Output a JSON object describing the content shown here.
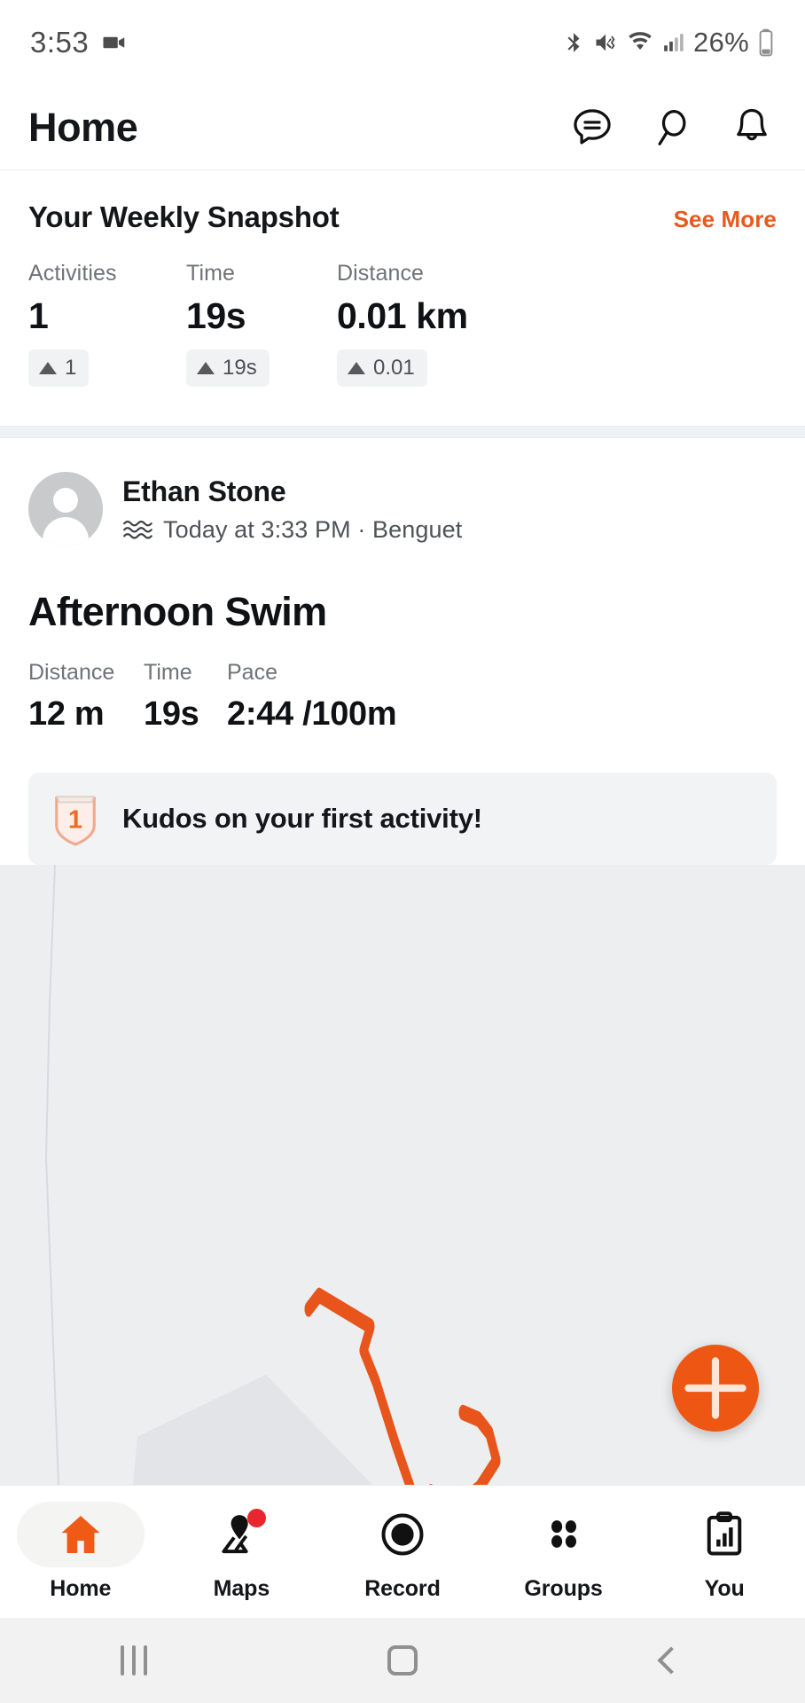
{
  "status_bar": {
    "time": "3:53",
    "battery_percent": "26%",
    "icons": [
      "video-recording-icon",
      "bluetooth-icon",
      "mute-vibrate-icon",
      "wifi-icon",
      "cellular-signal-icon",
      "battery-icon"
    ]
  },
  "app_bar": {
    "title": "Home",
    "actions": [
      {
        "name": "messages-icon",
        "label": "Messages"
      },
      {
        "name": "search-icon",
        "label": "Search"
      },
      {
        "name": "notifications-bell-icon",
        "label": "Notifications"
      }
    ]
  },
  "snapshot": {
    "title": "Your Weekly Snapshot",
    "see_more_label": "See More",
    "accent_color": "#e8591f",
    "stats": [
      {
        "label": "Activities",
        "value": "1",
        "delta": "1",
        "trend": "up"
      },
      {
        "label": "Time",
        "value": "19s",
        "delta": "19s",
        "trend": "up"
      },
      {
        "label": "Distance",
        "value": "0.01 km",
        "delta": "0.01",
        "trend": "up"
      }
    ]
  },
  "activity": {
    "user_name": "Ethan Stone",
    "sport_icon": "swim-waves-icon",
    "meta": "Today at 3:33 PM · Benguet",
    "title": "Afternoon Swim",
    "stats": [
      {
        "label": "Distance",
        "value": "12 m"
      },
      {
        "label": "Time",
        "value": "19s"
      },
      {
        "label": "Pace",
        "value": "2:44 /100m"
      }
    ],
    "kudos": {
      "badge_number": "1",
      "text": "Kudos on your first activity!"
    },
    "map": {
      "route_color": "#e8551c",
      "background_color": "#eceef0",
      "fab_label": "+",
      "fab_color": "#ee5713"
    }
  },
  "bottom_nav": {
    "items": [
      {
        "label": "Home",
        "icon": "home-icon",
        "active": true,
        "badge": false
      },
      {
        "label": "Maps",
        "icon": "maps-pin-icon",
        "active": false,
        "badge": true
      },
      {
        "label": "Record",
        "icon": "record-circle-icon",
        "active": false,
        "badge": false
      },
      {
        "label": "Groups",
        "icon": "groups-dots-icon",
        "active": false,
        "badge": false
      },
      {
        "label": "You",
        "icon": "you-clipboard-chart-icon",
        "active": false,
        "badge": false
      }
    ]
  },
  "android_nav": {
    "recents": "recents-icon",
    "home": "home-square-icon",
    "back": "back-chevron-icon"
  }
}
